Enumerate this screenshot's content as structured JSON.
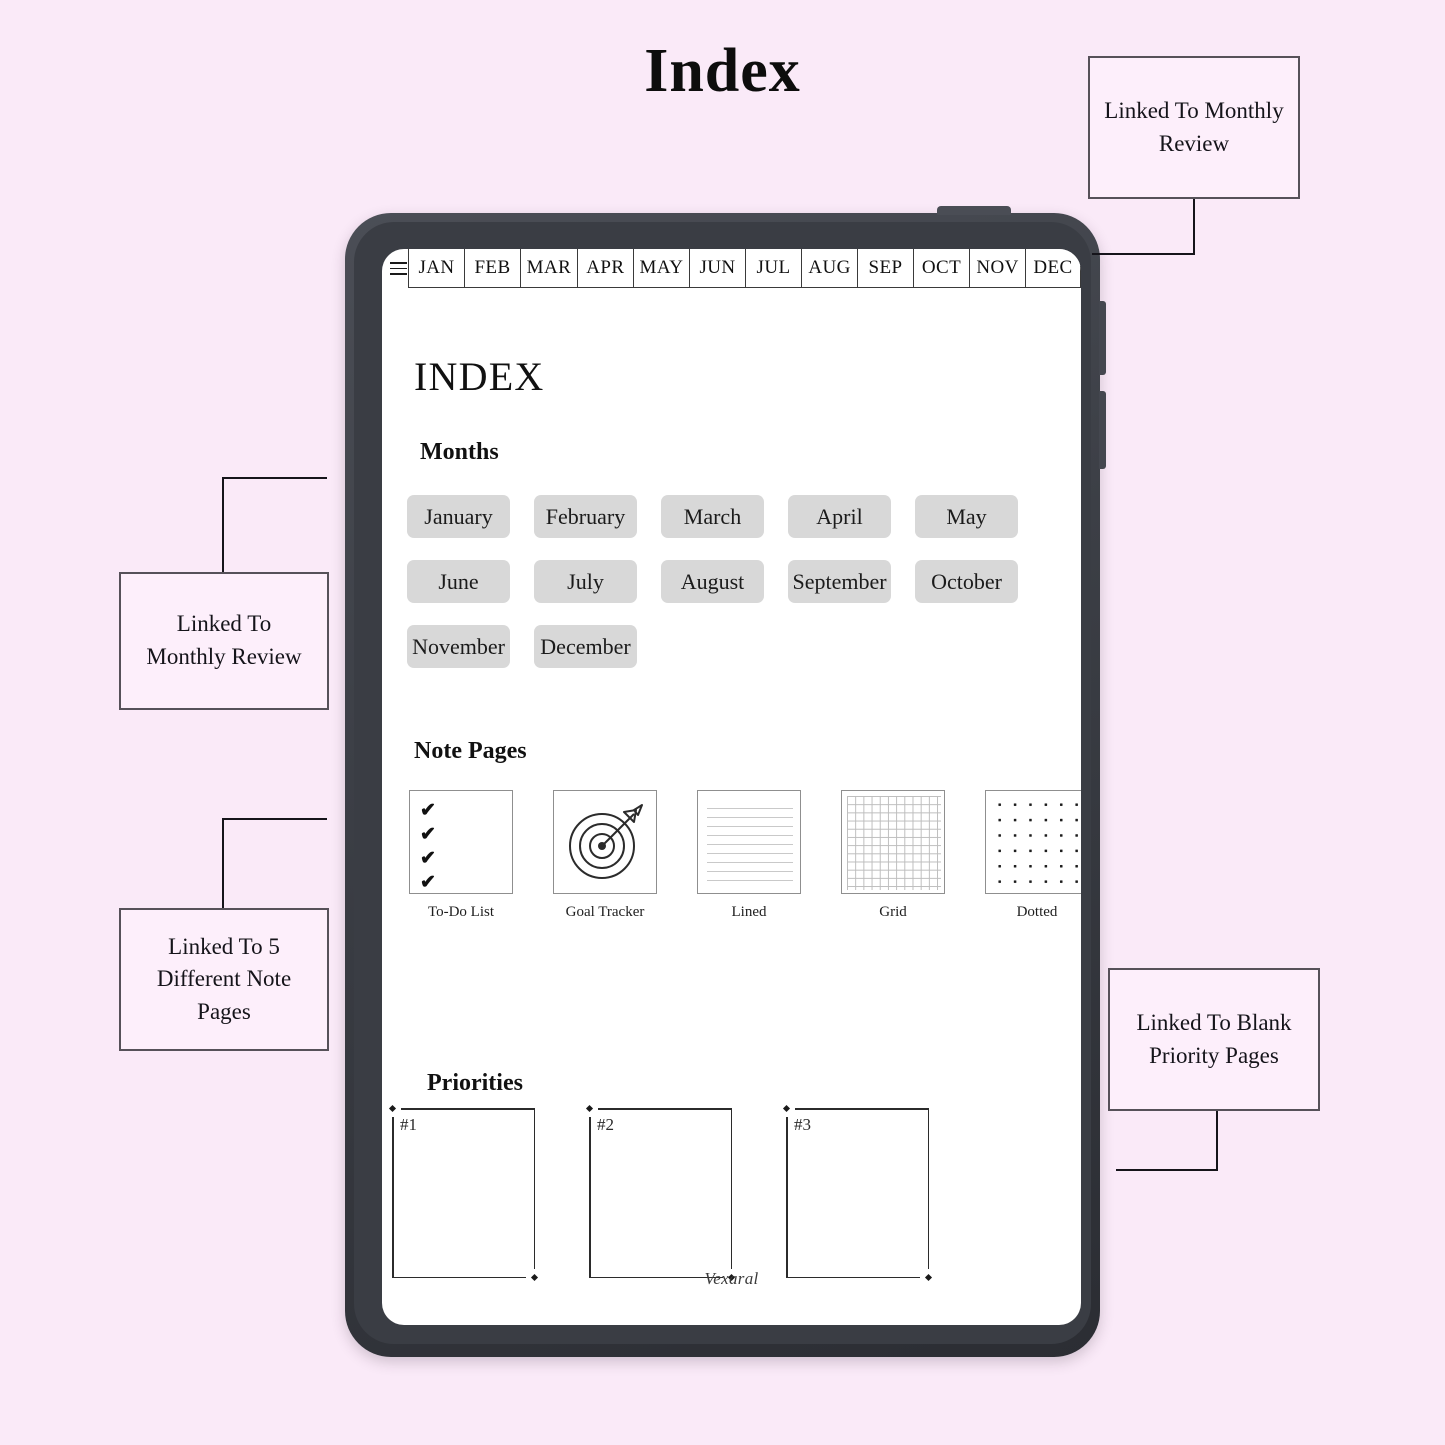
{
  "page": {
    "title": "Index",
    "background_color": "#faeaf8"
  },
  "callouts": [
    {
      "id": "monthly-top",
      "text": "Linked To Monthly Review"
    },
    {
      "id": "monthly-left",
      "text": "Linked To Monthly Review"
    },
    {
      "id": "notes-left",
      "text": "Linked To 5 Different Note Pages"
    },
    {
      "id": "priority-right",
      "text": "Linked To Blank Priority Pages"
    }
  ],
  "tablet": {
    "frame_color": "#3c3f46",
    "screen": {
      "month_tabs": {
        "menu_icon": "hamburger-icon",
        "items": [
          "JAN",
          "FEB",
          "MAR",
          "APR",
          "MAY",
          "JUN",
          "JUL",
          "AUG",
          "SEP",
          "OCT",
          "NOV",
          "DEC"
        ]
      },
      "heading": "INDEX",
      "sections": {
        "months": {
          "heading": "Months",
          "chips": [
            "January",
            "February",
            "March",
            "April",
            "May",
            "June",
            "July",
            "August",
            "September",
            "October",
            "November",
            "December"
          ],
          "chip_color": "#d8d8d8"
        },
        "note_pages": {
          "heading": "Note Pages",
          "thumbs": [
            {
              "label": "To-Do List",
              "icon": "checklist-icon"
            },
            {
              "label": "Goal Tracker",
              "icon": "target-arrow-icon"
            },
            {
              "label": "Lined",
              "icon": "lined-paper-icon"
            },
            {
              "label": "Grid",
              "icon": "grid-paper-icon"
            },
            {
              "label": "Dotted",
              "icon": "dotted-paper-icon"
            }
          ]
        },
        "priorities": {
          "heading": "Priorities",
          "boxes": [
            {
              "number": "#1"
            },
            {
              "number": "#2"
            },
            {
              "number": "#3"
            }
          ]
        }
      },
      "footer_brand": "Vexaral"
    }
  }
}
